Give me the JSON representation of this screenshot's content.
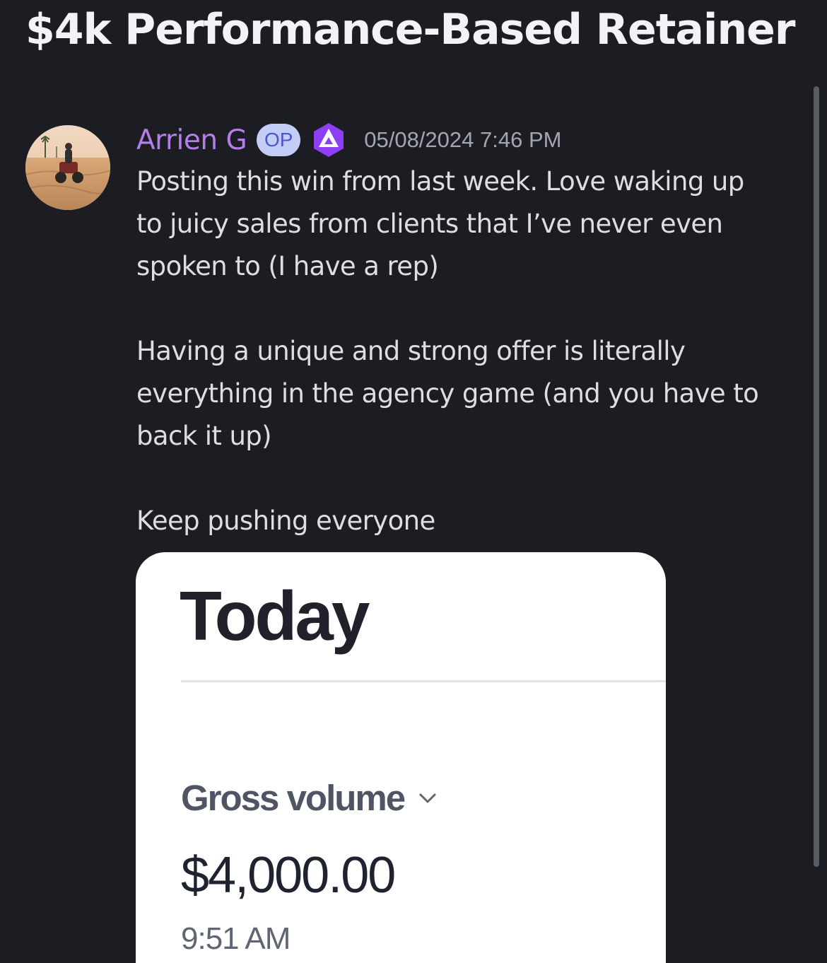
{
  "thread": {
    "title": "$4k Performance-Based Retainer"
  },
  "message": {
    "author": {
      "name": "Arrien G",
      "name_color": "#b47de8",
      "avatar_icon": "user-avatar-atv-desert",
      "badge": "OP",
      "role_icon": "purple-a-role-icon"
    },
    "timestamp": "05/08/2024 7:46 PM",
    "paragraphs": [
      "Posting this win from last week. Love waking up\nto juicy sales from clients that I’ve never even\nspoken to (I have a rep)",
      "Having a unique and strong offer is literally\neverything in the agency game (and you have to\nback it up)",
      "Keep pushing everyone"
    ]
  },
  "attachment": {
    "heading": "Today",
    "metric_label": "Gross volume",
    "metric_dropdown_icon": "chevron-down-icon",
    "amount": "$4,000.00",
    "time": "9:51 AM"
  },
  "colors": {
    "background": "#1c1d22",
    "title": "#f2f3f5",
    "body_text": "#dcdee3",
    "timestamp": "#a4a6ad",
    "op_badge_bg": "#c3cdf6",
    "op_badge_text": "#4a56d0",
    "role_icon": "#8e3ff5"
  }
}
